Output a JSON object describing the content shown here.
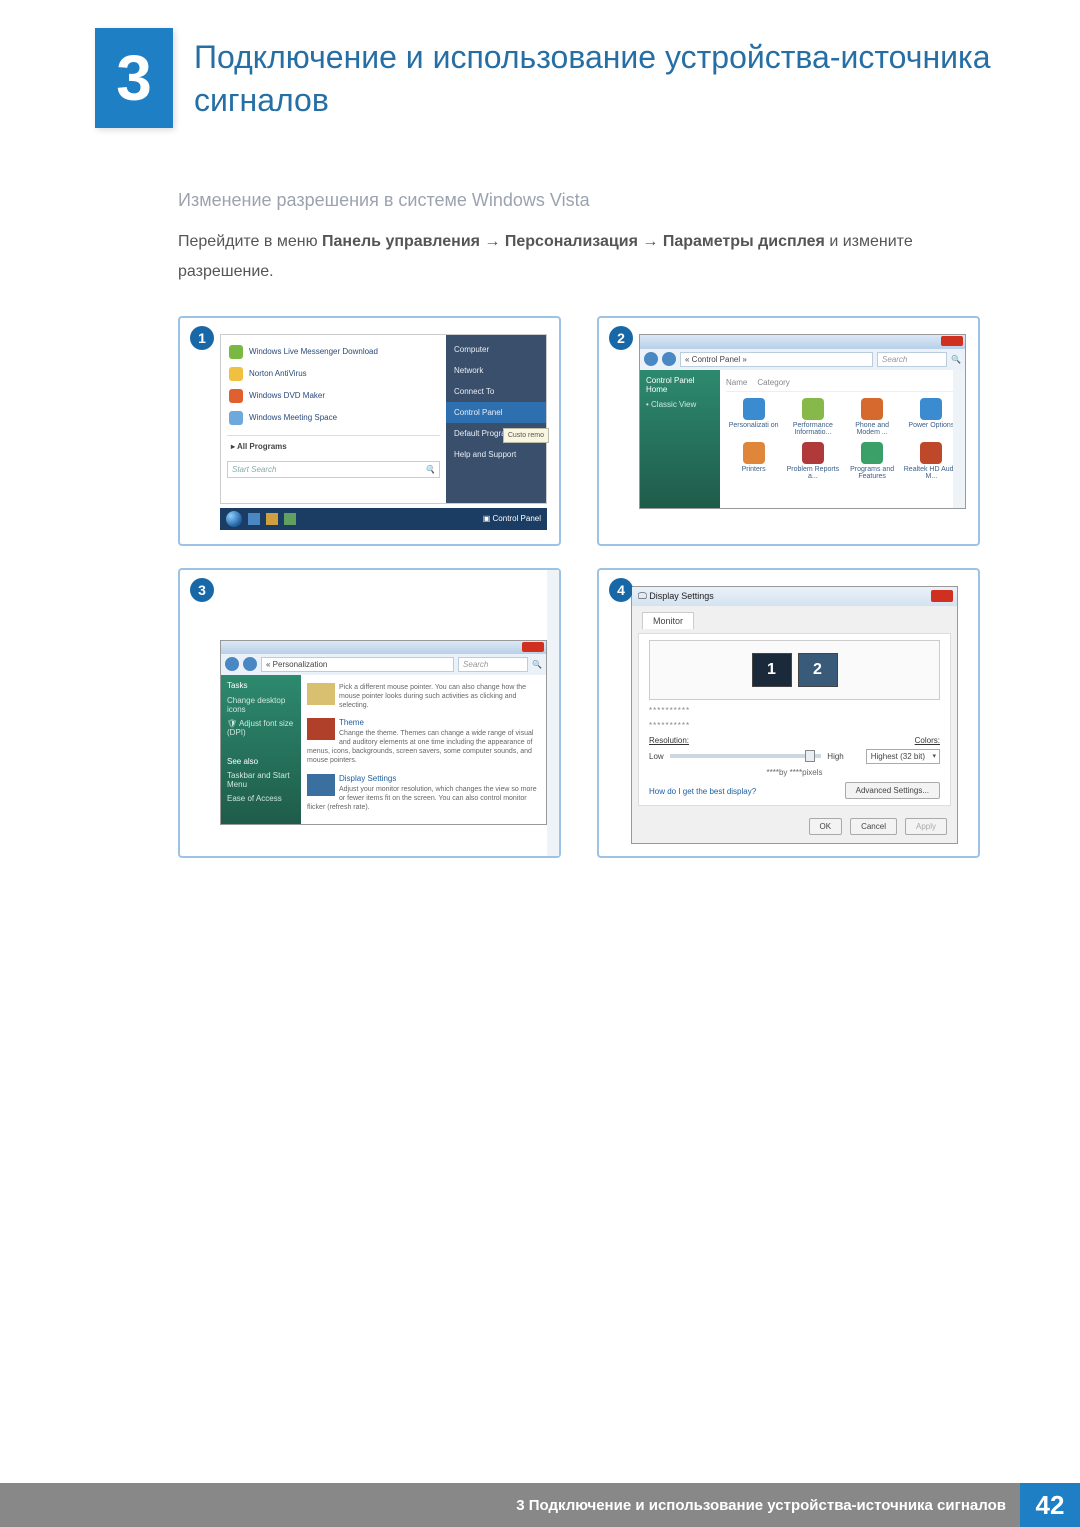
{
  "chapter": {
    "number": "3",
    "title": "Подключение и использование устройства-источника сигналов"
  },
  "subheading": "Изменение разрешения в системе Windows Vista",
  "instruction": {
    "pre": "Перейдите в меню ",
    "b1": "Панель управления",
    "arrow": " → ",
    "b2": "Персонализация",
    "b3": "Параметры дисплея",
    "post": " и измените разрешение."
  },
  "steps": {
    "s1": "1",
    "s2": "2",
    "s3": "3",
    "s4": "4"
  },
  "panel1": {
    "items": [
      "Windows Live Messenger Download",
      "Norton AntiVirus",
      "Windows DVD Maker",
      "Windows Meeting Space"
    ],
    "all_programs": "All Programs",
    "right": [
      "Computer",
      "Network",
      "Connect To",
      "Control Panel",
      "Default Programs",
      "Help and Support"
    ],
    "search_placeholder": "Start Search",
    "task_label": "Control Panel",
    "tooltip": "Custo remo"
  },
  "panel2": {
    "addr": "« Control Panel »",
    "search_ph": "Search",
    "side": {
      "home": "Control Panel Home",
      "classic": "Classic View"
    },
    "cols": {
      "name": "Name",
      "category": "Category"
    },
    "items": [
      "Personalizati on",
      "Performance Informatio...",
      "Phone and Modem ...",
      "Power Options",
      "Printers",
      "Problem Reports a...",
      "Programs and Features",
      "Realtek HD Audio M..."
    ],
    "colors": [
      "#3a8bd0",
      "#86b84a",
      "#d66a2e",
      "#3a8bd0",
      "#e0863a",
      "#b03a3a",
      "#3aa068",
      "#c0482a"
    ]
  },
  "panel3": {
    "addr": "« Personalization",
    "search_ph": "Search",
    "side": {
      "tasks": "Tasks",
      "links": [
        "Change desktop icons",
        "Adjust font size (DPI)"
      ],
      "see_also": "See also",
      "links2": [
        "Taskbar and Start Menu",
        "Ease of Access"
      ]
    },
    "blocks": [
      {
        "title": "",
        "desc": "Pick a different mouse pointer. You can also change how the mouse pointer looks during such activities as clicking and selecting."
      },
      {
        "title": "Theme",
        "desc": "Change the theme. Themes can change a wide range of visual and auditory elements at one time including the appearance of menus, icons, backgrounds, screen savers, some computer sounds, and mouse pointers."
      },
      {
        "title": "Display Settings",
        "desc": "Adjust your monitor resolution, which changes the view so more or fewer items fit on the screen. You can also control monitor flicker (refresh rate)."
      }
    ]
  },
  "panel4": {
    "title": "Display Settings",
    "tab": "Monitor",
    "mon1": "1",
    "mon2": "2",
    "stars": "**********",
    "res_label": "Resolution:",
    "col_label": "Colors:",
    "low": "Low",
    "high": "High",
    "color_opt": "Highest (32 bit)",
    "pixels": "****by ****pixels",
    "link": "How do I get the best display?",
    "adv": "Advanced Settings...",
    "ok": "OK",
    "cancel": "Cancel",
    "apply": "Apply"
  },
  "footer": {
    "text": "3 Подключение и использование устройства-источника сигналов",
    "page": "42"
  }
}
